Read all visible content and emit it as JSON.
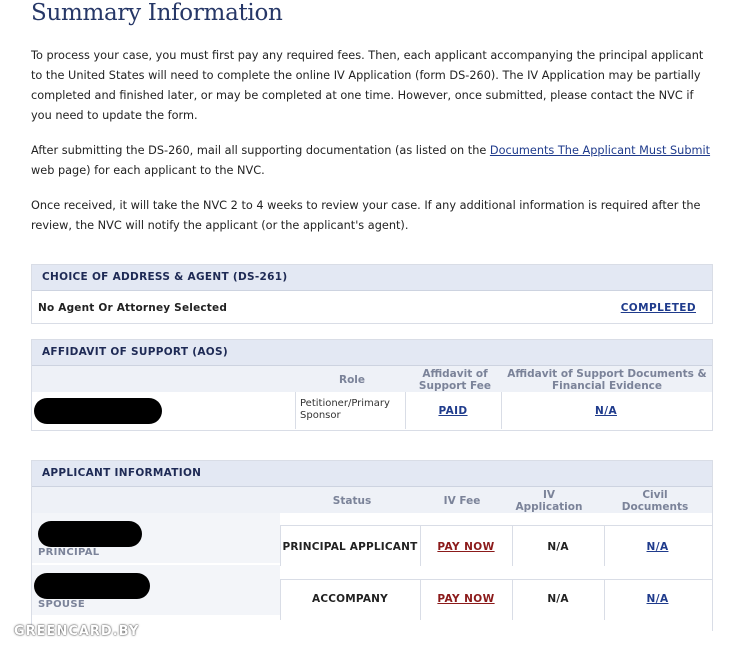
{
  "page": {
    "title": "Summary Information",
    "para1": "To process your case, you must first pay any required fees. Then, each applicant accompanying the principal applicant to the United States will need to complete the online IV Application (form DS-260). The IV Application may be partially completed and finished later, or may be completed at one time. However, once submitted, please contact the NVC if you need to update the form.",
    "para2_before": "After submitting the DS-260, mail all supporting documentation (as listed on the ",
    "para2_link": "Documents The Applicant Must Submit",
    "para2_after": " web page) for each applicant to the NVC.",
    "para3": "Once received, it will take the NVC 2 to 4 weeks to review your case. If any additional information is required after the review, the NVC will notify the applicant (or the applicant's agent)."
  },
  "agent_panel": {
    "header": "CHOICE OF ADDRESS & AGENT (DS-261)",
    "row_label": "No Agent Or Attorney Selected",
    "status": "COMPLETED"
  },
  "aos_panel": {
    "header": "AFFIDAVIT OF SUPPORT (AOS)",
    "col_role": "Role",
    "col_fee": "Affidavit of Support Fee",
    "col_docs": "Affidavit of Support Documents & Financial Evidence",
    "row": {
      "role": "Petitioner/Primary Sponsor",
      "fee": "PAID",
      "docs": "N/A"
    }
  },
  "applicant_panel": {
    "header": "APPLICANT INFORMATION",
    "col_status": "Status",
    "col_ivfee": "IV Fee",
    "col_ivapp": "IV Application",
    "col_civil": "Civil Documents",
    "rows": [
      {
        "type": "PRINCIPAL",
        "status": "PRINCIPAL APPLICANT",
        "ivfee": "PAY NOW",
        "ivapp": "N/A",
        "civil": "N/A"
      },
      {
        "type": "SPOUSE",
        "status": "ACCOMPANY",
        "ivfee": "PAY NOW",
        "ivapp": "N/A",
        "civil": "N/A"
      }
    ]
  },
  "watermark": "GREENCARD.BY"
}
